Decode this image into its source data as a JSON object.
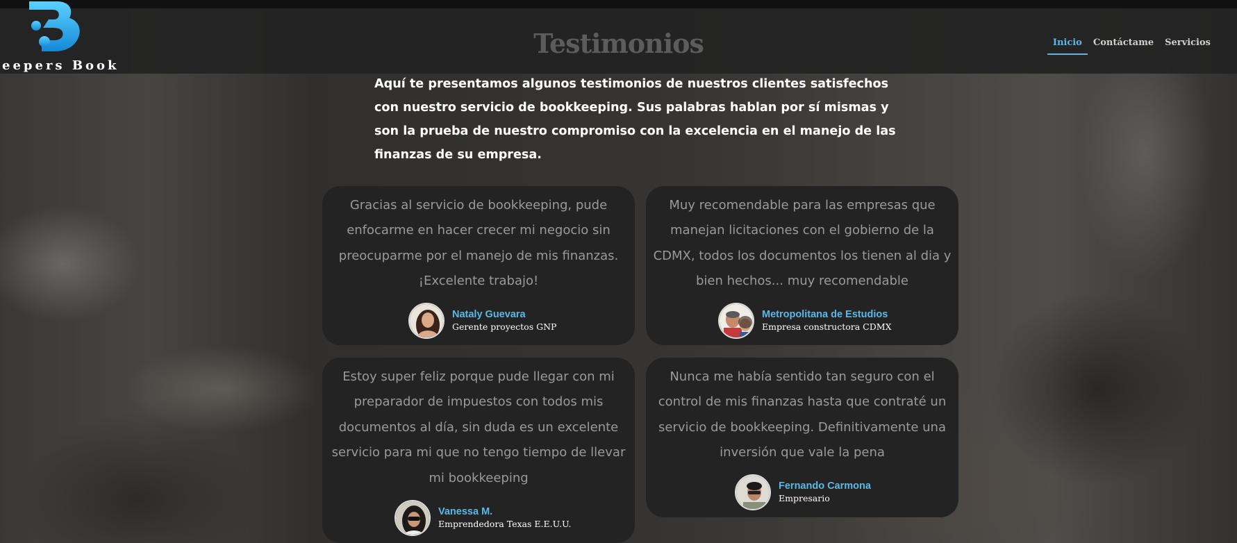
{
  "brand": {
    "logo_text": "eepers Book",
    "logo_color": "#27a8e8"
  },
  "header": {
    "title": "Testimonios"
  },
  "nav": {
    "items": [
      {
        "label": "Inicio",
        "active": true
      },
      {
        "label": "Contáctame",
        "active": false
      },
      {
        "label": "Servicios",
        "active": false
      }
    ]
  },
  "intro": {
    "text": "Aquí te presentamos algunos testimonios de nuestros clientes satisfechos con nuestro servicio de bookkeeping. Sus palabras hablan por sí mismas y son la prueba de nuestro compromiso con la excelencia en el manejo de las finanzas de su empresa."
  },
  "testimonials": [
    {
      "quote": "Gracias al servicio de bookkeeping, pude enfocarme en hacer crecer mi negocio sin preocuparme por el manejo de mis finanzas. ¡Excelente trabajo!",
      "name": "Nataly Guevara",
      "role": "Gerente proyectos GNP"
    },
    {
      "quote": "Muy recomendable para las empresas que manejan licitaciones con el gobierno de la CDMX, todos los documentos los tienen al dia y bien hechos... muy recomendable",
      "name": "Metropolitana de Estudios",
      "role": "Empresa constructora CDMX"
    },
    {
      "quote": "Estoy super feliz porque pude llegar con mi preparador de impuestos con todos mis documentos al día, sin duda es un excelente servicio para mi que no tengo tiempo de llevar mi bookkeeping",
      "name": "Vanessa M.",
      "role": "Emprendedora Texas E.E.U.U."
    },
    {
      "quote": "Nunca me había sentido tan seguro con el control de mis finanzas hasta que contraté un servicio de bookkeeping. Definitivamente una inversión que vale la pena",
      "name": "Fernando Carmona",
      "role": "Empresario"
    }
  ],
  "colors": {
    "accent": "#5bb8e6",
    "card_bg": "#232323",
    "header_bg": "#222222"
  }
}
